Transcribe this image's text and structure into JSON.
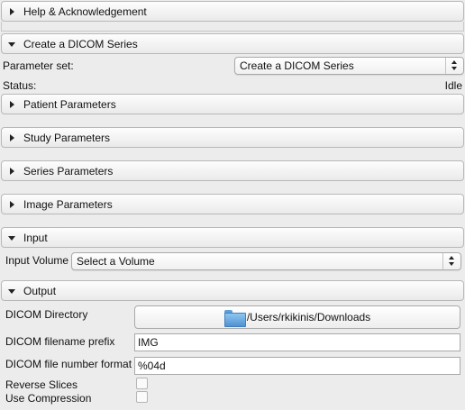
{
  "sections": {
    "help": "Help & Acknowledgement",
    "create": "Create a DICOM Series",
    "patient": "Patient Parameters",
    "study": "Study Parameters",
    "series": "Series Parameters",
    "image": "Image Parameters",
    "input": "Input",
    "output": "Output"
  },
  "create": {
    "parameter_set_label": "Parameter set:",
    "parameter_set_value": "Create a DICOM Series",
    "status_label": "Status:",
    "status_value": "Idle"
  },
  "input": {
    "volume_label": "Input Volume",
    "volume_value": "Select a Volume"
  },
  "output": {
    "directory_label": "DICOM Directory",
    "directory_value": "/Users/rkikinis/Downloads",
    "prefix_label": "DICOM filename prefix",
    "prefix_value": "IMG",
    "number_format_label": "DICOM file number format",
    "number_format_value": "%04d",
    "reverse_slices_label": "Reverse Slices",
    "reverse_slices_checked": false,
    "use_compression_label": "Use Compression",
    "use_compression_checked": false
  }
}
